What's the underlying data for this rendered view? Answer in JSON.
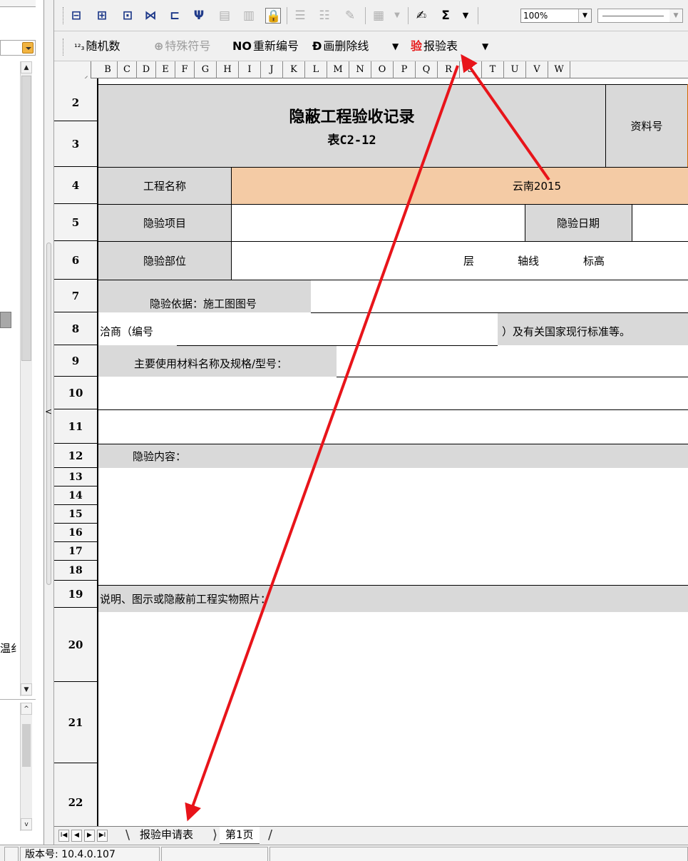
{
  "toolbar1": {
    "zoom": "100%",
    "sum_symbol": "Σ"
  },
  "toolbar2": {
    "random_icon": "¹²₃",
    "random_label": "随机数",
    "special_char_label": "特殊符号",
    "renumber_icon": "NO",
    "renumber_label": "重新编号",
    "strikethrough_icon": "Ð",
    "strikethrough_label": "画删除线",
    "report_icon": "验",
    "report_label": "报验表"
  },
  "columns": [
    "B",
    "C",
    "D",
    "E",
    "F",
    "G",
    "H",
    "I",
    "J",
    "K",
    "L",
    "M",
    "N",
    "O",
    "P",
    "Q",
    "R",
    "S",
    "T",
    "U",
    "V",
    "W"
  ],
  "rows": [
    "2",
    "3",
    "4",
    "5",
    "6",
    "7",
    "8",
    "9",
    "10",
    "11",
    "12",
    "13",
    "14",
    "15",
    "16",
    "17",
    "18",
    "19",
    "20",
    "21",
    "22"
  ],
  "form": {
    "title": "隐蔽工程验收记录",
    "subtitle": "表C2-12",
    "doc_no_label": "资料号",
    "project_name_label": "工程名称",
    "project_name_value": "云南2015",
    "inspection_item_label": "隐验项目",
    "inspection_date_label": "隐验日期",
    "inspection_part_label": "隐验部位",
    "floor_label": "层",
    "axis_label": "轴线",
    "elevation_label": "标高",
    "basis_label": "隐验依据：施工图图号",
    "negotiation_prefix": "洽商（编号",
    "negotiation_suffix": "）及有关国家现行标准等。",
    "materials_label": "主要使用材料名称及规格/型号：",
    "content_label": "隐验内容：",
    "notes_label": "说明、图示或隐蔽前工程实物照片："
  },
  "sheet_tabs": {
    "report_tab": "报验申请表",
    "page1_tab": "第1页"
  },
  "status_bar": {
    "version": "版本号: 10.4.0.107"
  },
  "left_panel": {
    "partial_text": "温纟"
  },
  "colors": {
    "project_cell_bg": "#f4cba5",
    "grey_cell_bg": "#d9d9d9",
    "arrow": "#e8141a"
  }
}
